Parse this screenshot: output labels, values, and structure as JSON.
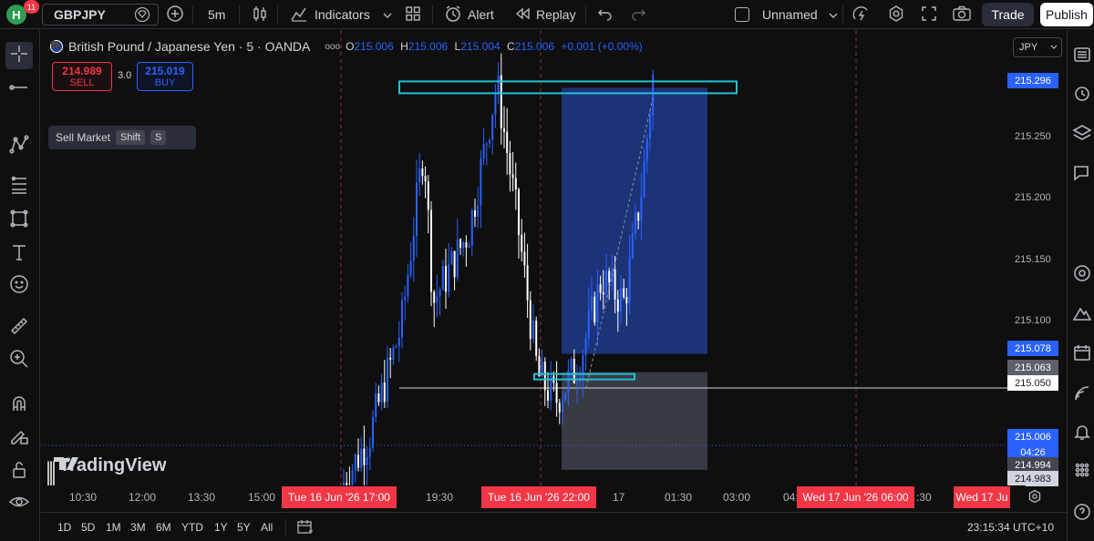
{
  "topbar": {
    "avatar_letter": "H",
    "notifications": "11",
    "symbol": "GBPJPY",
    "interval": "5m",
    "indicators": "Indicators",
    "alert": "Alert",
    "replay": "Replay",
    "layout_name": "Unnamed",
    "trade": "Trade",
    "publish": "Publish"
  },
  "legend": {
    "title": "British Pound / Japanese Yen · 5 · OANDA",
    "open_label": "O",
    "open": "215.006",
    "high_label": "H",
    "high": "215.006",
    "low_label": "L",
    "low": "215.004",
    "close_label": "C",
    "close": "215.006",
    "change": "+0.001 (+0.00%)"
  },
  "order_panel": {
    "sell_price": "214.989",
    "sell_label": "SELL",
    "spread": "3.0",
    "buy_price": "215.019",
    "buy_label": "BUY"
  },
  "tooltip": {
    "text": "Sell Market",
    "key1": "Shift",
    "key2": "S"
  },
  "logo": {
    "text": "TradingView"
  },
  "price_axis": {
    "currency": "JPY",
    "ticks": [
      "215.250",
      "215.200",
      "215.150",
      "215.100"
    ],
    "tags": {
      "target": "215.296",
      "entry": "215.078",
      "stop_top": "215.063",
      "line": "215.050",
      "last": "215.006",
      "countdown": "04:26",
      "bid": "214.994",
      "ask_low": "214.983"
    }
  },
  "time_axis": {
    "labels": [
      "10:30",
      "12:00",
      "13:30",
      "15:00",
      "19:30",
      "17",
      "01:30",
      "03:00",
      "04:",
      ":30"
    ],
    "highlight_tags": [
      "Tue 16 Jun '26   17:00",
      "Tue 16 Jun '26   22:00",
      "Wed 17 Jun '26   06:00",
      "Wed 17 Ju"
    ]
  },
  "bottombar": {
    "ranges": [
      "1D",
      "5D",
      "1M",
      "3M",
      "6M",
      "YTD",
      "1Y",
      "5Y",
      "All"
    ],
    "clock": "23:15:34 UTC+10"
  },
  "colors": {
    "up": "#2962ff",
    "down": "#ffffff",
    "accent_red": "#f23645",
    "zone_cyan": "#22c1d6",
    "target_zone": "#1e3a8a",
    "stop_zone": "#434651"
  },
  "chart_data": {
    "type": "candlestick",
    "title": "British Pound / Japanese Yen · 5 · OANDA",
    "xlabel": "",
    "ylabel": "",
    "ylim": [
      214.975,
      215.31
    ],
    "x_ticks": [
      "10:30",
      "12:00",
      "13:30",
      "15:00",
      "17:00",
      "19:30",
      "22:00",
      "17",
      "01:30",
      "03:00",
      "06:00"
    ],
    "position": {
      "kind": "long",
      "entry": 215.078,
      "target": 215.296,
      "stop": 215.063
    },
    "horizontal_line": 215.05,
    "last_price": 215.006
  }
}
